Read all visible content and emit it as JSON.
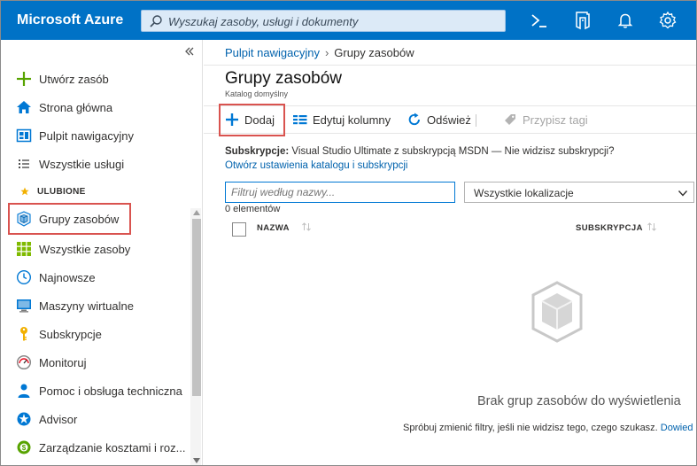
{
  "topbar": {
    "brand": "Microsoft Azure",
    "search_placeholder": "Wyszukaj zasoby, usługi i dokumenty",
    "icons": [
      "cloud-shell-icon",
      "directory-filter-icon",
      "notifications-bell-icon",
      "settings-gear-icon"
    ],
    "bg_color": "#0072c6"
  },
  "sidebar": {
    "items": [
      {
        "label": "Utwórz zasób",
        "icon": "plus-icon"
      },
      {
        "label": "Strona główna",
        "icon": "home-icon"
      },
      {
        "label": "Pulpit nawigacyjny",
        "icon": "dashboard-icon"
      },
      {
        "label": "Wszystkie usługi",
        "icon": "list-icon"
      }
    ],
    "favorites_header": "ULUBIONE",
    "favorites": [
      {
        "label": "Grupy zasobów",
        "icon": "resource-group-cube-icon"
      },
      {
        "label": "Wszystkie zasoby",
        "icon": "grid-icon"
      },
      {
        "label": "Najnowsze",
        "icon": "clock-icon"
      },
      {
        "label": "Maszyny wirtualne",
        "icon": "monitor-icon"
      },
      {
        "label": "Subskrypcje",
        "icon": "key-icon"
      },
      {
        "label": "Monitoruj",
        "icon": "gauge-icon"
      },
      {
        "label": "Pomoc i obsługa techniczna",
        "icon": "support-person-icon"
      },
      {
        "label": "Advisor",
        "icon": "advisor-icon"
      },
      {
        "label": "Zarządzanie kosztami i roz...",
        "icon": "cost-icon"
      }
    ]
  },
  "main": {
    "breadcrumb": {
      "link": "Pulpit nawigacyjny",
      "current": "Grupy zasobów"
    },
    "title": "Grupy zasobów",
    "subtitle": "Katalog domyślny",
    "commands": {
      "add": "Dodaj",
      "edit_columns": "Edytuj kolumny",
      "refresh": "Odśwież",
      "assign_tags": "Przypisz tagi"
    },
    "subscriptions_label": "Subskrypcje:",
    "subscriptions_text": " Visual Studio Ultimate z subskrypcją MSDN — Nie widzisz subskrypcji?",
    "settings_link": "Otwórz ustawienia katalogu i subskrypcji",
    "filter_placeholder": "Filtruj według nazwy...",
    "location_select": "Wszystkie lokalizacje",
    "count": "0 elementów",
    "columns": {
      "name": "NAZWA",
      "subscription": "SUBSKRYPCJA"
    },
    "empty_title": "Brak grup zasobów do wyświetlenia",
    "empty_hint": "Spróbuj zmienić filtry, jeśli nie widzisz tego, czego szukasz. ",
    "empty_link": "Dowied"
  }
}
